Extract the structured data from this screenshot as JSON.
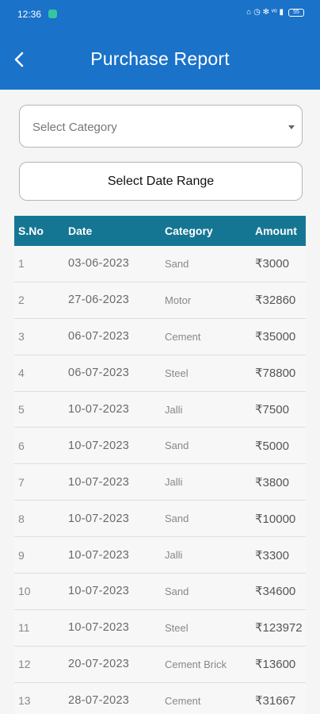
{
  "status": {
    "time": "12:36",
    "icons": "⌂ ◷ ✻ ᵛᵒ ▮",
    "battery": "55"
  },
  "appbar": {
    "back_icon": "chevron-left-icon",
    "title": "Purchase Report"
  },
  "filters": {
    "category_placeholder": "Select Category",
    "date_range_label": "Select Date Range"
  },
  "table": {
    "headers": [
      "S.No",
      "Date",
      "Category",
      "Amount"
    ],
    "rows": [
      {
        "sno": "1",
        "date": "03-06-2023",
        "category": "Sand",
        "amount": "₹3000"
      },
      {
        "sno": "2",
        "date": "27-06-2023",
        "category": "Motor",
        "amount": "₹32860"
      },
      {
        "sno": "3",
        "date": "06-07-2023",
        "category": "Cement",
        "amount": "₹35000"
      },
      {
        "sno": "4",
        "date": "06-07-2023",
        "category": "Steel",
        "amount": "₹78800"
      },
      {
        "sno": "5",
        "date": "10-07-2023",
        "category": "Jalli",
        "amount": "₹7500"
      },
      {
        "sno": "6",
        "date": "10-07-2023",
        "category": "Sand",
        "amount": "₹5000"
      },
      {
        "sno": "7",
        "date": "10-07-2023",
        "category": "Jalli",
        "amount": "₹3800"
      },
      {
        "sno": "8",
        "date": "10-07-2023",
        "category": "Sand",
        "amount": "₹10000"
      },
      {
        "sno": "9",
        "date": "10-07-2023",
        "category": "Jalli",
        "amount": "₹3300"
      },
      {
        "sno": "10",
        "date": "10-07-2023",
        "category": "Sand",
        "amount": "₹34600"
      },
      {
        "sno": "11",
        "date": "10-07-2023",
        "category": "Steel",
        "amount": "₹123972"
      },
      {
        "sno": "12",
        "date": "20-07-2023",
        "category": "Cement Brick",
        "amount": "₹13600"
      },
      {
        "sno": "13",
        "date": "28-07-2023",
        "category": "Cement",
        "amount": "₹31667"
      }
    ]
  },
  "colors": {
    "appbar": "#1a72c9",
    "table_header": "#157693",
    "background": "#f5f5f5"
  }
}
